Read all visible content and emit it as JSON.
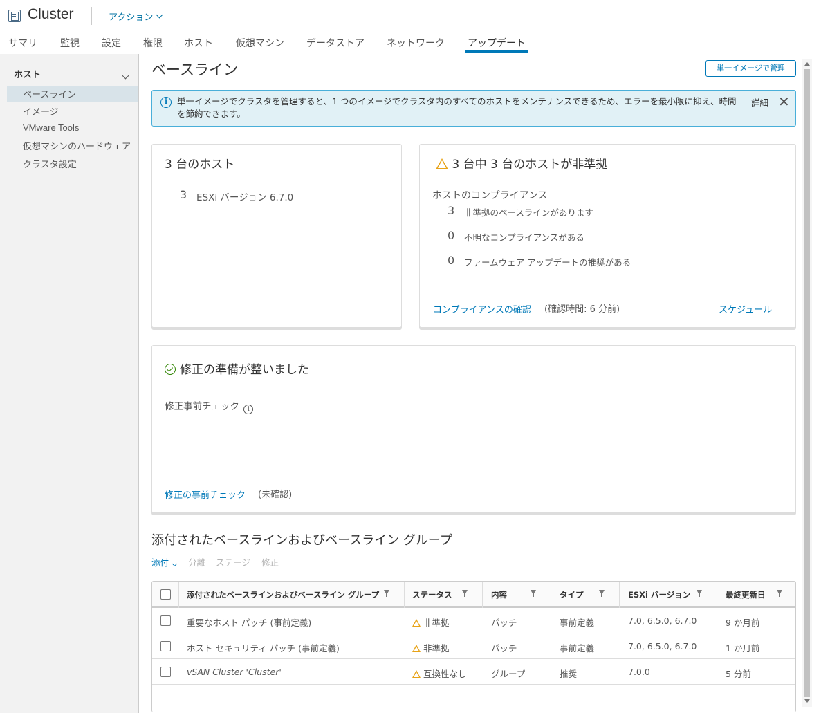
{
  "header": {
    "title": "Cluster",
    "actions_label": "アクション"
  },
  "tabs": [
    {
      "label": "サマリ"
    },
    {
      "label": "監視"
    },
    {
      "label": "設定"
    },
    {
      "label": "権限"
    },
    {
      "label": "ホスト"
    },
    {
      "label": "仮想マシン"
    },
    {
      "label": "データストア"
    },
    {
      "label": "ネットワーク"
    },
    {
      "label": "アップデート",
      "active": true
    }
  ],
  "sidebar": {
    "heading": "ホスト",
    "items": [
      {
        "label": "ベースライン",
        "selected": true
      },
      {
        "label": "イメージ"
      },
      {
        "label": "VMware Tools"
      },
      {
        "label": "仮想マシンのハードウェア"
      },
      {
        "label": "クラスタ設定"
      }
    ]
  },
  "page": {
    "title": "ベースライン",
    "manage_button": "単一イメージで管理"
  },
  "alert": {
    "text": "単一イメージでクラスタを管理すると、1 つのイメージでクラスタ内のすべてのホストをメンテナンスできるため、エラーを最小限に抑え、時間を節約できます。",
    "link": "詳細"
  },
  "hosts_card": {
    "title": "3 台のホスト",
    "count": "3",
    "version_label": "ESXi バージョン 6.7.0"
  },
  "compliance_card": {
    "title": "3 台中 3 台のホストが非準拠",
    "section_label": "ホストのコンプライアンス",
    "rows": [
      {
        "count": "3",
        "label": "非準拠のベースラインがあります"
      },
      {
        "count": "0",
        "label": "不明なコンプライアンスがある"
      },
      {
        "count": "0",
        "label": "ファームウェア アップデートの推奨がある"
      }
    ],
    "check_link": "コンプライアンスの確認",
    "check_time": "(確認時間: 6 分前)",
    "schedule_link": "スケジュール"
  },
  "remediation_card": {
    "title": "修正の準備が整いました",
    "precheck_label": "修正事前チェック",
    "precheck_link": "修正の事前チェック",
    "precheck_status": "(未確認)"
  },
  "attached": {
    "title": "添付されたベースラインおよびベースライン グループ",
    "toolbar": {
      "attach": "添付",
      "detach": "分離",
      "stage": "ステージ",
      "remediate": "修正"
    },
    "columns": [
      "添付されたベースラインおよびベースライン グループ",
      "ステータス",
      "内容",
      "タイプ",
      "ESXi バージョン",
      "最終更新日"
    ],
    "rows": [
      {
        "name": "重要なホスト パッチ (事前定義)",
        "status": "非準拠",
        "content": "パッチ",
        "type": "事前定義",
        "versions": "7.0, 6.5.0, 6.7.0",
        "updated": "9 か月前"
      },
      {
        "name": "ホスト セキュリティ パッチ (事前定義)",
        "status": "非準拠",
        "content": "パッチ",
        "type": "事前定義",
        "versions": "7.0, 6.5.0, 6.7.0",
        "updated": "1 か月前"
      },
      {
        "name": "vSAN Cluster 'Cluster'",
        "status": "互換性なし",
        "content": "グループ",
        "type": "推奨",
        "versions": "7.0.0",
        "updated": "5 分前"
      }
    ]
  },
  "colors": {
    "accent": "#0079b8",
    "warning": "#e8a317",
    "success": "#2f8400",
    "alert_bg": "#e1f1f6"
  }
}
